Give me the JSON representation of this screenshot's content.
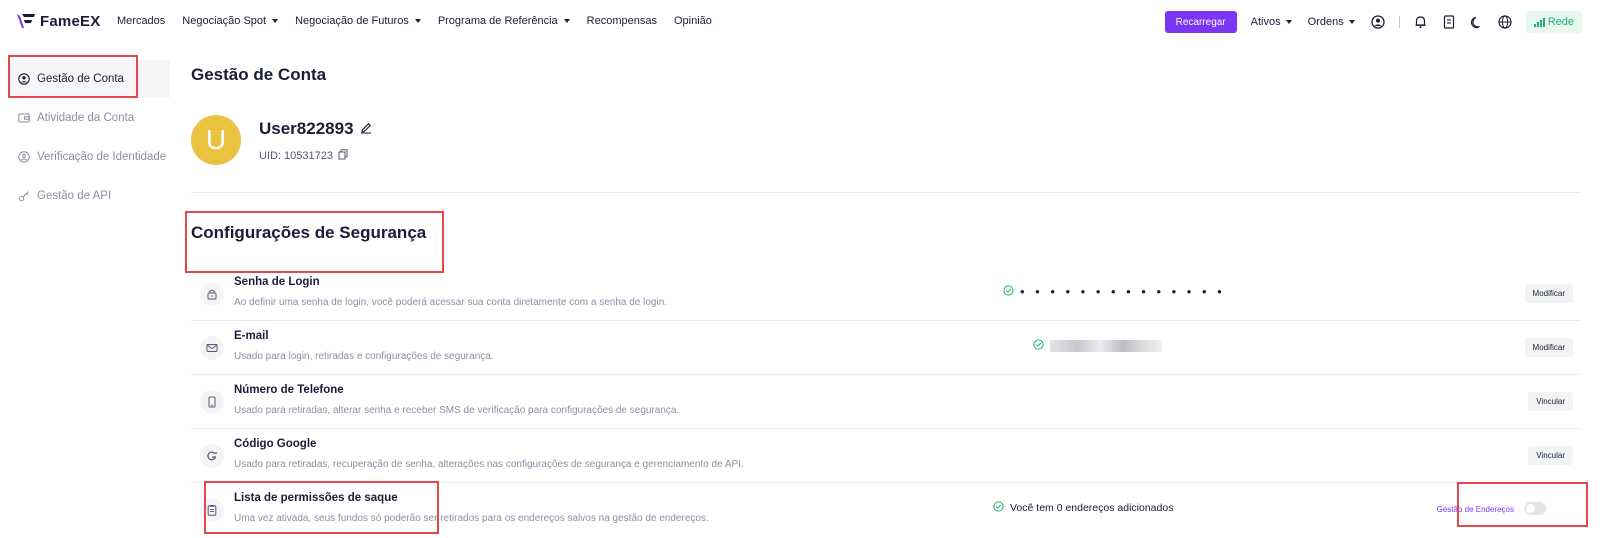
{
  "brand": {
    "name": "FameEX",
    "accent": "#7a35f5"
  },
  "nav": {
    "items": [
      {
        "label": "Mercados",
        "has_dropdown": false
      },
      {
        "label": "Negociação Spot",
        "has_dropdown": true
      },
      {
        "label": "Negociação de Futuros",
        "has_dropdown": true
      },
      {
        "label": "Programa de Referência",
        "has_dropdown": true
      },
      {
        "label": "Recompensas",
        "has_dropdown": false
      },
      {
        "label": "Opinião",
        "has_dropdown": false
      }
    ],
    "recharge_label": "Recarregar",
    "assets_label": "Ativos",
    "orders_label": "Ordens",
    "network_label": "Rede",
    "icons": [
      "user-icon",
      "bell-icon",
      "document-icon",
      "moon-icon",
      "globe-icon",
      "signal-icon"
    ]
  },
  "sidebar": {
    "items": [
      {
        "label": "Gestão de Conta",
        "icon": "user-circle-icon",
        "active": true
      },
      {
        "label": "Atividade da Conta",
        "icon": "wallet-icon",
        "active": false
      },
      {
        "label": "Verificação de Identidade",
        "icon": "id-icon",
        "active": false
      },
      {
        "label": "Gestão de API",
        "icon": "key-icon",
        "active": false
      }
    ]
  },
  "account": {
    "title": "Gestão de Conta",
    "avatar_letter": "U",
    "username": "User822893",
    "uid_label": "UID: 10531723"
  },
  "security": {
    "title": "Configurações de Segurança",
    "rows": [
      {
        "title": "Senha de Login",
        "desc": "Ao definir uma senha de login, você poderá acessar sua conta diretamente com a senha de login.",
        "status": "• • • • • • • • • • • • • •",
        "button": "Modificar",
        "icon": "lock-icon"
      },
      {
        "title": "E-mail",
        "desc": "Usado para login, retiradas e configurações de segurança.",
        "status": "",
        "button": "Modificar",
        "icon": "mail-icon"
      },
      {
        "title": "Número de Telefone",
        "desc": "Usado para retiradas, alterar senha e receber SMS de verificação para configurações de segurança.",
        "status": "",
        "button": "Vincular",
        "icon": "phone-icon"
      },
      {
        "title": "Código Google",
        "desc": "Usado para retiradas, recuperação de senha, alterações nas configurações de segurança e gerenciamento de API.",
        "status": "",
        "button": "Vincular",
        "icon": "google-icon"
      },
      {
        "title": "Lista de permissões de saque",
        "desc": "Uma vez ativada, seus fundos só poderão ser retirados para os endereços salvos na gestão de endereços.",
        "status": "Você tem 0 endereços adicionados",
        "link": "Gestão de Endereços",
        "toggle_on": false,
        "icon": "clipboard-icon"
      }
    ]
  },
  "colors": {
    "highlight": "#e5474b",
    "success": "#20b26c",
    "avatar": "#e9c23f"
  }
}
